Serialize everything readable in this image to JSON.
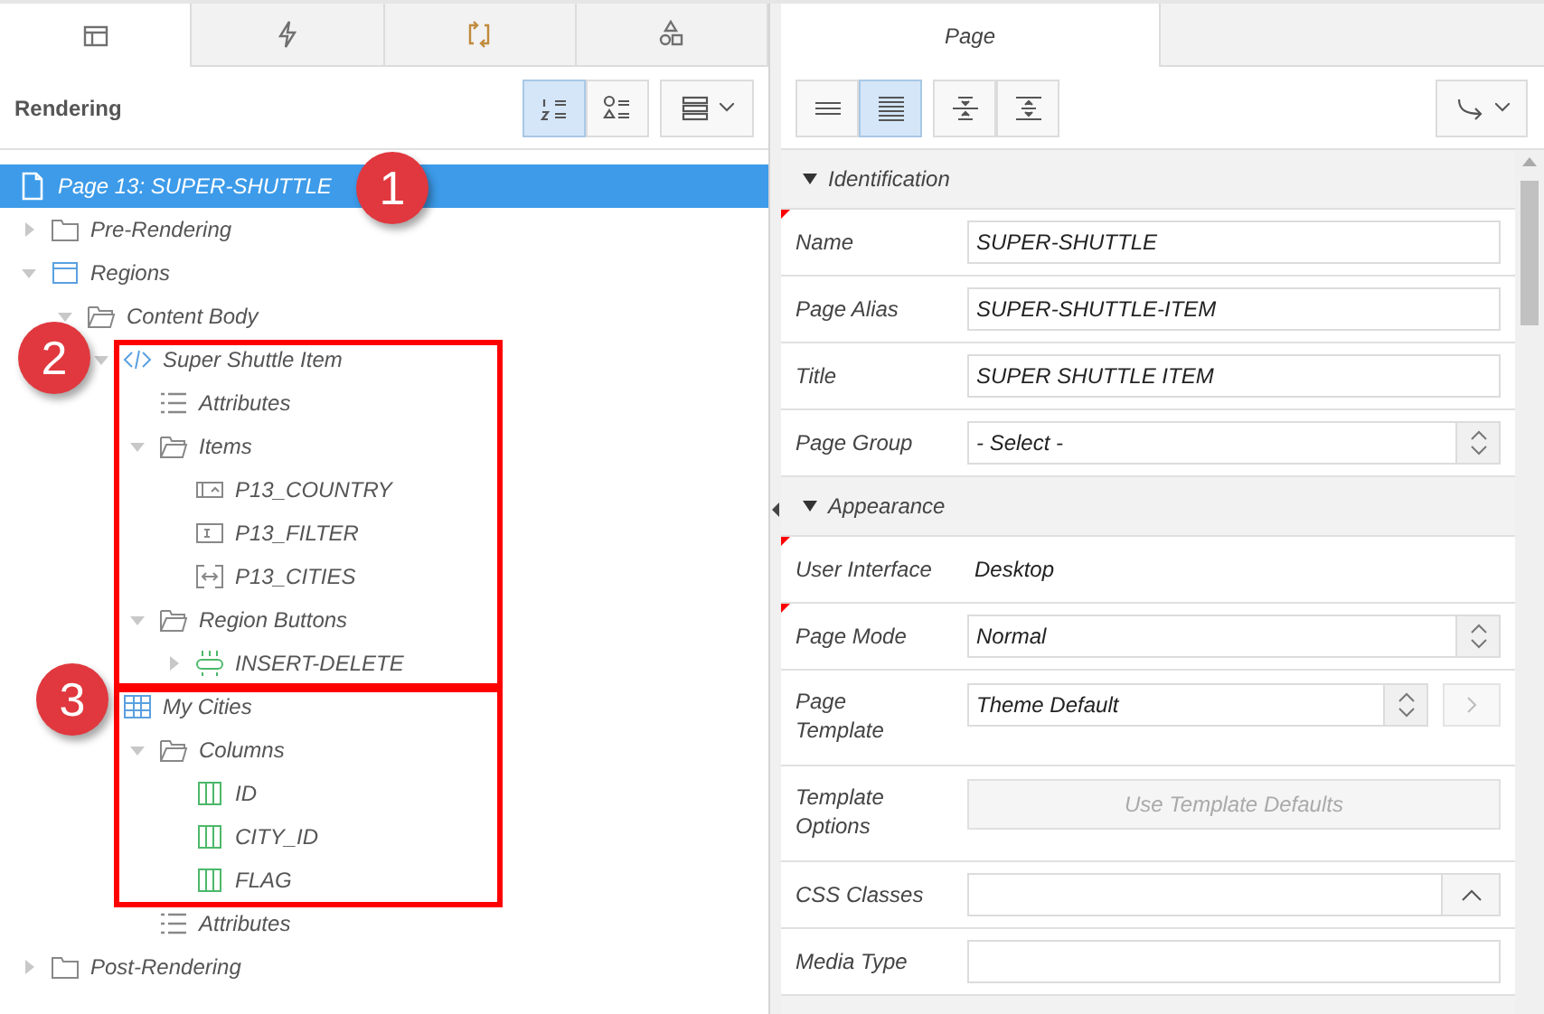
{
  "left_panel": {
    "tabs": [
      {
        "selected": true
      },
      {
        "selected": false
      },
      {
        "selected": false
      },
      {
        "selected": false
      }
    ],
    "toolbar": {
      "title": "Rendering",
      "view_buttons": [
        {
          "selected": true
        },
        {
          "selected": false
        }
      ]
    },
    "tree": [
      {
        "label": "Page 13: SUPER-SHUTTLE",
        "kind": "page",
        "selected": true,
        "children": [
          {
            "label": "Pre-Rendering",
            "kind": "folder",
            "expanded": false,
            "selected": false
          },
          {
            "label": "Regions",
            "kind": "region",
            "expanded": true,
            "selected": false,
            "children": [
              {
                "label": "Content Body",
                "kind": "folder-open",
                "expanded": true,
                "selected": false,
                "children": [
                  {
                    "label": "Super Shuttle Item",
                    "kind": "code",
                    "expanded": true,
                    "selected": false,
                    "children": [
                      {
                        "label": "Attributes",
                        "kind": "attributes",
                        "selected": false
                      },
                      {
                        "label": "Items",
                        "kind": "folder-open",
                        "expanded": true,
                        "selected": false,
                        "children": [
                          {
                            "label": "P13_COUNTRY",
                            "kind": "select-item",
                            "selected": false
                          },
                          {
                            "label": "P13_FILTER",
                            "kind": "text-item",
                            "selected": false
                          },
                          {
                            "label": "P13_CITIES",
                            "kind": "shuttle-item",
                            "selected": false
                          }
                        ]
                      },
                      {
                        "label": "Region Buttons",
                        "kind": "folder-open",
                        "expanded": true,
                        "selected": false,
                        "children": [
                          {
                            "label": "INSERT-DELETE",
                            "kind": "button",
                            "expanded": false,
                            "selected": false
                          }
                        ]
                      }
                    ]
                  },
                  {
                    "label": "My Cities",
                    "kind": "report",
                    "selected": false,
                    "children": [
                      {
                        "label": "Columns",
                        "kind": "folder-open",
                        "expanded": true,
                        "selected": false,
                        "children": [
                          {
                            "label": "ID",
                            "kind": "column",
                            "selected": false
                          },
                          {
                            "label": "CITY_ID",
                            "kind": "column",
                            "selected": false
                          },
                          {
                            "label": "FLAG",
                            "kind": "column",
                            "selected": false
                          }
                        ]
                      },
                      {
                        "label": "Attributes",
                        "kind": "attributes",
                        "selected": false
                      }
                    ]
                  }
                ]
              }
            ]
          },
          {
            "label": "Post-Rendering",
            "kind": "folder",
            "expanded": false,
            "selected": false
          }
        ]
      }
    ],
    "annotations": [
      {
        "label": "1"
      },
      {
        "label": "2"
      },
      {
        "label": "3"
      }
    ]
  },
  "right_panel": {
    "tabs": [
      {
        "label": "Page",
        "selected": true
      }
    ],
    "toolbar": {
      "buttons": [
        {
          "selected": false
        },
        {
          "selected": true
        },
        {
          "selected": false
        },
        {
          "selected": false
        }
      ]
    },
    "sections": [
      {
        "title": "Identification",
        "expanded": true,
        "properties": [
          {
            "label": "Name",
            "kind": "text",
            "value": "SUPER-SHUTTLE",
            "required": true
          },
          {
            "label": "Page Alias",
            "kind": "text",
            "value": "SUPER-SHUTTLE-ITEM",
            "required": false
          },
          {
            "label": "Title",
            "kind": "text",
            "value": "SUPER SHUTTLE ITEM",
            "required": false
          },
          {
            "label": "Page Group",
            "kind": "select",
            "value": "- Select -",
            "required": false
          }
        ]
      },
      {
        "title": "Appearance",
        "expanded": true,
        "properties": [
          {
            "label": "User Interface",
            "kind": "display",
            "value": "Desktop",
            "required": true
          },
          {
            "label": "Page Mode",
            "kind": "select",
            "value": "Normal",
            "required": true
          },
          {
            "label": "Page Template",
            "kind": "select-link",
            "value": "Theme Default",
            "required": false
          },
          {
            "label": "Template Options",
            "kind": "button",
            "value": "Use Template Defaults",
            "required": false
          },
          {
            "label": "CSS Classes",
            "kind": "text-picker",
            "required": false
          },
          {
            "label": "Media Type",
            "kind": "text",
            "required": false
          }
        ]
      }
    ]
  }
}
